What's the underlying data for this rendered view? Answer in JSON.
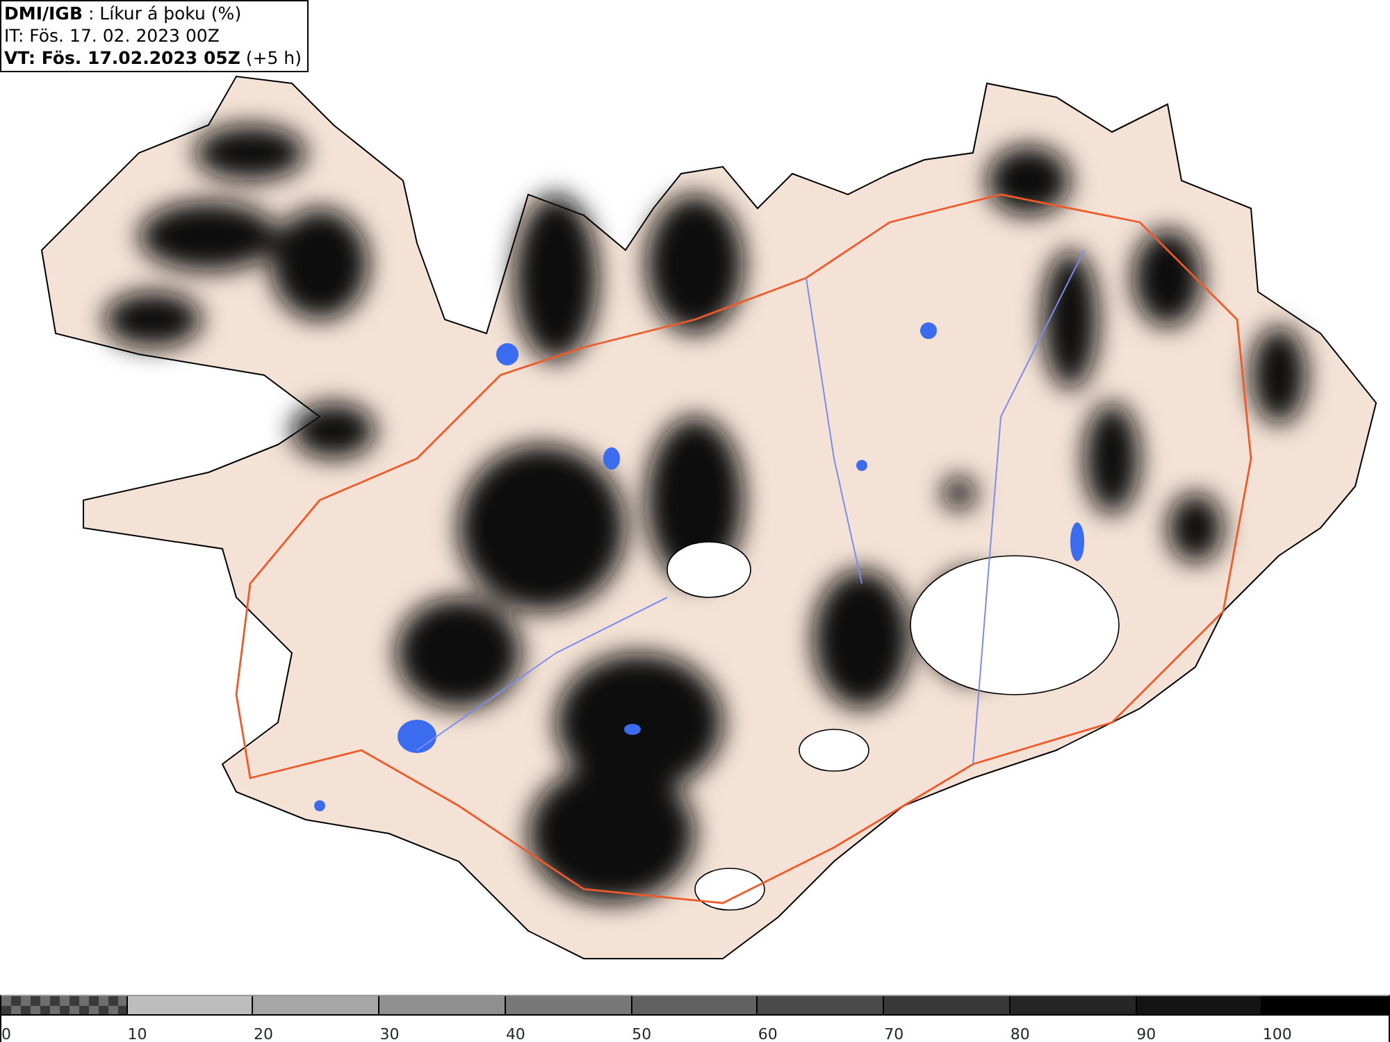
{
  "header": {
    "title": "**DMI/IGB** : Líkur á þoku (%)",
    "issue_time": "IT: Fös. 17. 02. 2023 00Z",
    "valid_time": "**VT: Fös. 17.02.2023 05Z** (+5 h)"
  },
  "legend": {
    "segments": [
      {
        "kind": "checker",
        "color": "#6e6e6e",
        "label": "0"
      },
      {
        "kind": "solid",
        "color": "#bdbdbd",
        "label": "10"
      },
      {
        "kind": "solid",
        "color": "#a6a6a6",
        "label": "20"
      },
      {
        "kind": "solid",
        "color": "#8f8f8f",
        "label": "30"
      },
      {
        "kind": "solid",
        "color": "#787878",
        "label": "40"
      },
      {
        "kind": "solid",
        "color": "#616161",
        "label": "50"
      },
      {
        "kind": "solid",
        "color": "#4a4a4a",
        "label": "60"
      },
      {
        "kind": "solid",
        "color": "#383838",
        "label": "70"
      },
      {
        "kind": "solid",
        "color": "#262626",
        "label": "80"
      },
      {
        "kind": "solid",
        "color": "#141414",
        "label": "90"
      },
      {
        "kind": "solid",
        "color": "#000000",
        "label": "100"
      }
    ]
  }
}
